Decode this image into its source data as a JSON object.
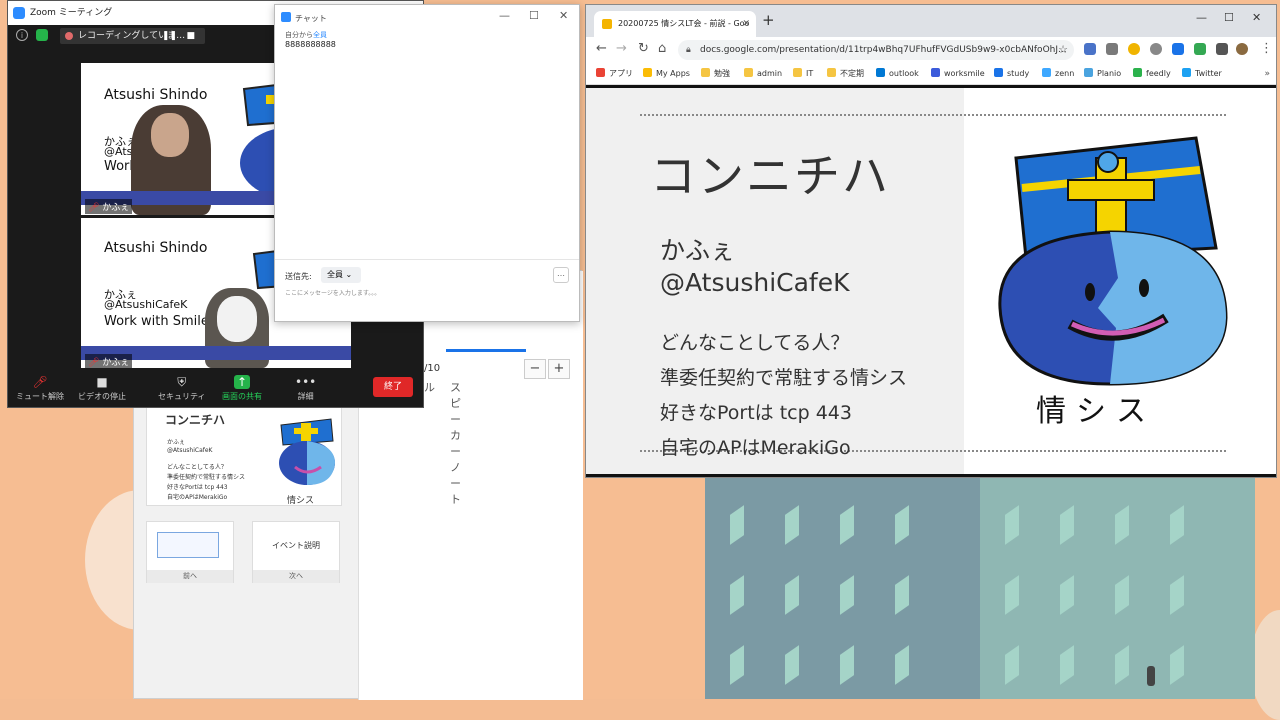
{
  "zoom": {
    "title": "Zoom ミーティング",
    "recording": "レコーディングしていま…",
    "tiles": [
      {
        "name": "Atsushi Shindo",
        "lines": [
          "かふぇ",
          "@Ats",
          "Work"
        ],
        "participant": "かふぇ"
      },
      {
        "name": "Atsushi Shindo",
        "lines": [
          "かふぇ",
          "@AtsushiCafeK",
          "Work with Smile"
        ],
        "participant": "かふぇ"
      }
    ],
    "toolbar": {
      "mute": "ミュート解除",
      "video": "ビデオの停止",
      "security": "セキュリティ",
      "share": "画面の共有",
      "more": "詳細",
      "end": "終了"
    }
  },
  "chat": {
    "title": "チャット",
    "from_prefix": "自分から",
    "from_target": "全員",
    "message": "8888888888",
    "to_label": "送信先:",
    "to_value": "全員",
    "placeholder": "ここにメッセージを入力します。。。",
    "more": "…"
  },
  "presenter": {
    "tab_partial": "ル",
    "tab_speaker": "スピーカー ノート",
    "count": "/10",
    "minus": "−",
    "plus": "+",
    "thumb": {
      "title": "コンニチハ",
      "lines": [
        "かふぇ",
        "@AtsushiCafeK",
        "どんなことしてる人？",
        "準委任契約で常駐する情シス",
        "好きなPortは tcp 443",
        "自宅のAPはMerakiGo"
      ],
      "kanji": "情シス"
    },
    "prev_label": "前へ",
    "next_label": "次へ",
    "next_title": "イベント説明"
  },
  "browser": {
    "tab_title": "20200725 情シスLT会 - 前説 - Goo",
    "url": "docs.google.com/presentation/d/11trp4wBhq7UFhufFVGdUSb9w9-x0cbANfoOhJ...",
    "bookmarks": [
      "アプリ",
      "My Apps",
      "勉強",
      "admin",
      "IT",
      "不定期",
      "outlook",
      "worksmile",
      "study",
      "zenn",
      "Planio",
      "feedly",
      "Twitter"
    ],
    "more": "»"
  },
  "slide": {
    "title": "コンニチハ",
    "name": "かふぇ",
    "handle": "@AtsushiCafeK",
    "items": [
      "どんなことしてる人？",
      "準委任契約で常駐する情シス",
      "好きなPortは tcp 443",
      "自宅のAPはMerakiGo"
    ],
    "kanji": "情シス"
  },
  "colors": {
    "desktop": "#f6bd92",
    "zoom_blue": "#2d8cff",
    "end_red": "#e02828",
    "hat_blue": "#1f6fd0",
    "hat_yellow": "#f5d400"
  }
}
